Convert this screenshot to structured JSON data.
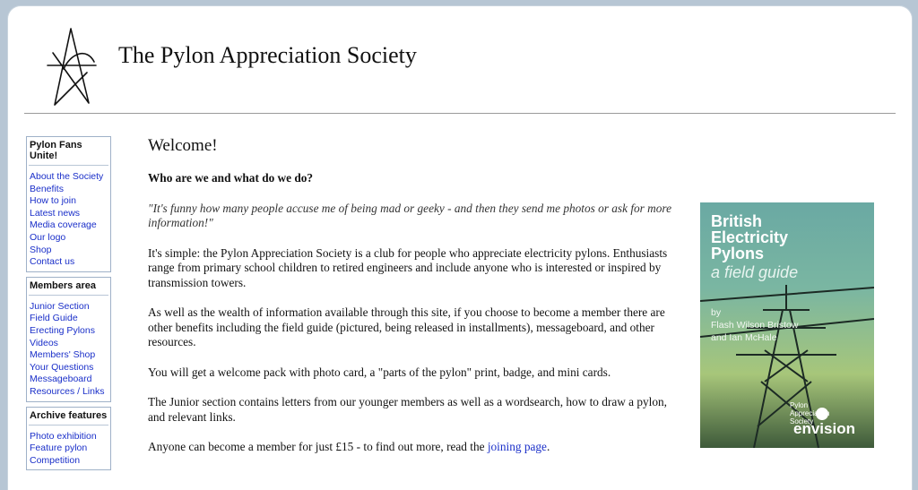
{
  "header": {
    "site_title": "The Pylon Appreciation Society"
  },
  "sidebar": {
    "sections": [
      {
        "title": "Pylon Fans Unite!",
        "items": [
          "About the Society",
          "Benefits",
          "How to join",
          "Latest news",
          "Media coverage",
          "Our logo",
          "Shop",
          "Contact us"
        ]
      },
      {
        "title": "Members area",
        "items": [
          "Junior Section",
          "Field Guide",
          "Erecting Pylons",
          "Videos",
          "Members' Shop",
          "Your Questions",
          "Messageboard",
          "Resources / Links"
        ]
      },
      {
        "title": "Archive features",
        "items": [
          "Photo exhibition",
          "Feature pylon",
          "Competition"
        ]
      }
    ]
  },
  "main": {
    "heading": "Welcome!",
    "subheading": "Who are we and what do we do?",
    "quote": "\"It's funny how many people accuse me of being mad or geeky - and then they send me photos or ask for more information!\"",
    "p1": "It's simple: the Pylon Appreciation Society is a club for people who appreciate electricity pylons. Enthusiasts range from primary school children to retired engineers and include anyone who is interested or inspired by transmission towers.",
    "p2": "As well as the wealth of information available through this site, if you choose to become a member there are other benefits including the field guide (pictured, being released in installments), messageboard, and other resources.",
    "p3": "You will get a welcome pack with photo card, a \"parts of the pylon\" print, badge, and mini cards.",
    "p4": "The Junior section contains letters from our younger members as well as a wordsearch, how to draw a pylon, and relevant links.",
    "p5_prefix": "Anyone can become a member for just £15 - to find out more, read the ",
    "p5_link": "joining page",
    "p5_suffix": "."
  },
  "book_cover": {
    "title_line1": "British",
    "title_line2": "Electricity",
    "title_line3": "Pylons",
    "subtitle": "a field guide",
    "by": "by",
    "author1": "Flash Wilson Bristow",
    "author2": "and Ian McHale",
    "publisher1_line1": "Pylon",
    "publisher1_line2": "Appreciation",
    "publisher1_line3": "Society",
    "publisher2": "envision"
  },
  "colors": {
    "page_background": "#b7c6d4",
    "link": "#1a2fc9",
    "box_border": "#9fb1c8"
  }
}
